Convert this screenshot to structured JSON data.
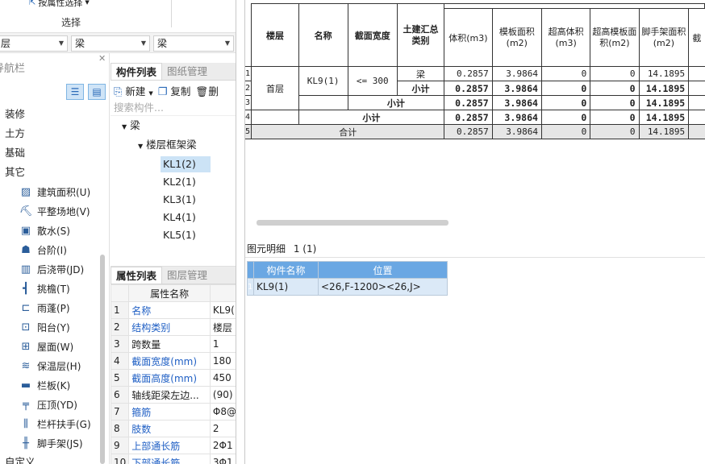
{
  "ribbon": {
    "button_label": "按属性选择",
    "group_label": "选择"
  },
  "filters": {
    "floor": "层",
    "type": "梁",
    "subtype": "梁"
  },
  "nav": {
    "title": "导航栏",
    "categories": [
      "装修",
      "土方",
      "基础",
      "其它"
    ],
    "items": [
      {
        "label": "建筑面积(U)",
        "icon": "building-area-icon",
        "glyph": "▨"
      },
      {
        "label": "平整场地(V)",
        "icon": "site-leveling-icon",
        "glyph": "⛏"
      },
      {
        "label": "散水(S)",
        "icon": "apron-icon",
        "glyph": "▣"
      },
      {
        "label": "台阶(I)",
        "icon": "steps-icon",
        "glyph": "☗"
      },
      {
        "label": "后浇带(JD)",
        "icon": "post-cast-strip-icon",
        "glyph": "▥"
      },
      {
        "label": "挑檐(T)",
        "icon": "cornice-icon",
        "glyph": "┫"
      },
      {
        "label": "雨蓬(P)",
        "icon": "canopy-icon",
        "glyph": "⊏"
      },
      {
        "label": "阳台(Y)",
        "icon": "balcony-icon",
        "glyph": "⊡"
      },
      {
        "label": "屋面(W)",
        "icon": "roof-icon",
        "glyph": "⊞"
      },
      {
        "label": "保温层(H)",
        "icon": "insulation-icon",
        "glyph": "≋"
      },
      {
        "label": "栏板(K)",
        "icon": "parapet-icon",
        "glyph": "▬"
      },
      {
        "label": "压顶(YD)",
        "icon": "coping-icon",
        "glyph": "╤"
      },
      {
        "label": "栏杆扶手(G)",
        "icon": "railing-icon",
        "glyph": "⫼"
      },
      {
        "label": "脚手架(JS)",
        "icon": "scaffold-icon",
        "glyph": "╫"
      }
    ],
    "footer": "自定义"
  },
  "components": {
    "tab_active": "构件列表",
    "tab_other": "图纸管理",
    "new_label": "新建",
    "copy_label": "复制",
    "delete_label": "删",
    "search_placeholder": "搜索构件...",
    "root": "梁",
    "group": "楼层框架梁",
    "leaves": [
      "KL1(2)",
      "KL2(1)",
      "KL3(1)",
      "KL4(1)",
      "KL5(1)"
    ]
  },
  "properties": {
    "tab_active": "属性列表",
    "tab_other": "图层管理",
    "header": "属性名称",
    "rows": [
      {
        "n": "1",
        "name": "名称",
        "val": "KL9(",
        "blue": true
      },
      {
        "n": "2",
        "name": "结构类别",
        "val": "楼层",
        "blue": true
      },
      {
        "n": "3",
        "name": "跨数量",
        "val": "1",
        "blue": false
      },
      {
        "n": "4",
        "name": "截面宽度(mm)",
        "val": "180",
        "blue": true
      },
      {
        "n": "5",
        "name": "截面高度(mm)",
        "val": "450",
        "blue": true
      },
      {
        "n": "6",
        "name": "轴线距梁左边...",
        "val": "(90)",
        "blue": false
      },
      {
        "n": "7",
        "name": "箍筋",
        "val": "Φ8@",
        "blue": true
      },
      {
        "n": "8",
        "name": "肢数",
        "val": "2",
        "blue": true
      },
      {
        "n": "9",
        "name": "上部通长筋",
        "val": "2Φ1",
        "blue": true
      },
      {
        "n": "10",
        "name": "下部通长筋",
        "val": "3Φ1",
        "blue": true
      }
    ]
  },
  "report": {
    "headers": {
      "floor": "楼层",
      "name": "名称",
      "width": "截面宽度",
      "category": "土建汇总类别",
      "volume": "体积(m3)",
      "formwork": "模板面积(m2)",
      "hvolume": "超高体积(m3)",
      "hformwork": "超高模板面积(m2)",
      "scaffold": "脚手架面积(m2)",
      "cut": "截"
    },
    "floor": "首层",
    "name": "KL9(1)",
    "width": "<= 300",
    "row_nums": [
      "1",
      "2",
      "3",
      "4",
      "5"
    ],
    "r1": {
      "cat": "梁",
      "v": "0.2857",
      "f": "3.9864",
      "hv": "0",
      "hf": "0",
      "s": "14.1895"
    },
    "r2": {
      "cat": "小计",
      "v": "0.2857",
      "f": "3.9864",
      "hv": "0",
      "hf": "0",
      "s": "14.1895"
    },
    "r3": {
      "cat": "小计",
      "v": "0.2857",
      "f": "3.9864",
      "hv": "0",
      "hf": "0",
      "s": "14.1895"
    },
    "r4": {
      "cat": "小计",
      "v": "0.2857",
      "f": "3.9864",
      "hv": "0",
      "hf": "0",
      "s": "14.1895"
    },
    "r5": {
      "cat": "合计",
      "v": "0.2857",
      "f": "3.9864",
      "hv": "0",
      "hf": "0",
      "s": "14.1895"
    }
  },
  "detail": {
    "title": "图元明细",
    "count": "1 (1)",
    "col_name": "构件名称",
    "col_pos": "位置",
    "row_num": "1",
    "name": "KL9(1)",
    "pos": "<26,F-1200><26,J>"
  }
}
